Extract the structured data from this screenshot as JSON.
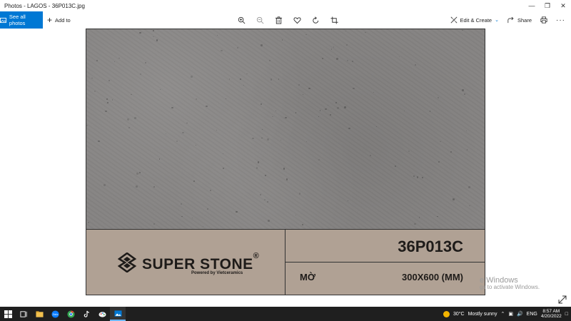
{
  "window": {
    "title": "Photos - LAGOS - 36P013C.jpg",
    "minimize_icon": "minimize-icon",
    "maximize_icon": "maximize-icon",
    "close_icon": "close-icon"
  },
  "toolbar": {
    "see_all_label": "See all photos",
    "add_to_label": "Add to",
    "edit_create_label": "Edit & Create",
    "share_label": "Share",
    "accent": "#0078d4"
  },
  "photo": {
    "stone_color": "#858382",
    "panel_color": "#b0a194",
    "brand": "SUPER STONE",
    "registered": "®",
    "powered_by": "Powered by Vietceramics",
    "code": "36P013C",
    "finish": "MỜ",
    "size": "300X600 (MM)"
  },
  "watermark": {
    "line1": "e Windows",
    "line2": "gs to activate Windows."
  },
  "taskbar": {
    "temperature": "30°C",
    "weather": "Mostly sunny",
    "language": "ENG",
    "time": "8:57 AM",
    "date": "4/20/2022"
  }
}
